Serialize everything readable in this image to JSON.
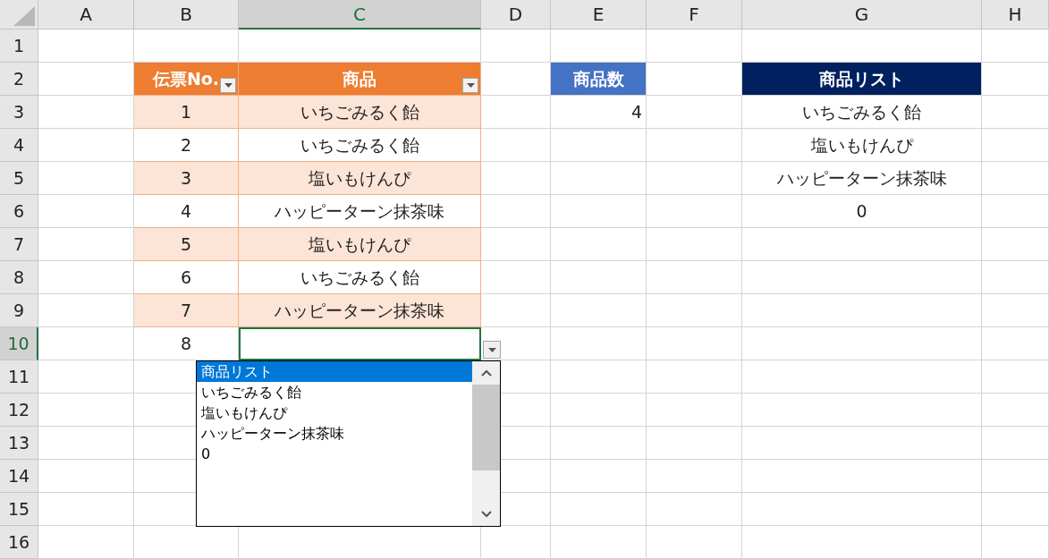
{
  "columns": [
    {
      "label": "A",
      "selected": false
    },
    {
      "label": "B",
      "selected": false
    },
    {
      "label": "C",
      "selected": true
    },
    {
      "label": "D",
      "selected": false
    },
    {
      "label": "E",
      "selected": false
    },
    {
      "label": "F",
      "selected": false
    },
    {
      "label": "G",
      "selected": false
    },
    {
      "label": "H",
      "selected": false
    }
  ],
  "rows": [
    {
      "label": "1",
      "selected": false
    },
    {
      "label": "2",
      "selected": false
    },
    {
      "label": "3",
      "selected": false
    },
    {
      "label": "4",
      "selected": false
    },
    {
      "label": "5",
      "selected": false
    },
    {
      "label": "6",
      "selected": false
    },
    {
      "label": "7",
      "selected": false
    },
    {
      "label": "8",
      "selected": false
    },
    {
      "label": "9",
      "selected": false
    },
    {
      "label": "10",
      "selected": true
    },
    {
      "label": "11",
      "selected": false
    },
    {
      "label": "12",
      "selected": false
    },
    {
      "label": "13",
      "selected": false
    },
    {
      "label": "14",
      "selected": false
    },
    {
      "label": "15",
      "selected": false
    },
    {
      "label": "16",
      "selected": false
    }
  ],
  "table": {
    "columns": [
      "伝票No.",
      "商品"
    ],
    "rows": [
      {
        "no": "1",
        "item": "いちごみるく飴"
      },
      {
        "no": "2",
        "item": "いちごみるく飴"
      },
      {
        "no": "3",
        "item": "塩いもけんぴ"
      },
      {
        "no": "4",
        "item": "ハッピーターン抹茶味"
      },
      {
        "no": "5",
        "item": "塩いもけんぴ"
      },
      {
        "no": "6",
        "item": "いちごみるく飴"
      },
      {
        "no": "7",
        "item": "ハッピーターン抹茶味"
      },
      {
        "no": "8"
      }
    ]
  },
  "count": {
    "header": "商品数",
    "value": "4"
  },
  "product_list": {
    "header": "商品リスト",
    "items": [
      "いちごみるく飴",
      "塩いもけんぴ",
      "ハッピーターン抹茶味",
      "0"
    ]
  },
  "dropdown": {
    "items": [
      {
        "label": "商品リスト",
        "selected": true
      },
      {
        "label": "いちごみるく飴",
        "selected": false
      },
      {
        "label": "塩いもけんぴ",
        "selected": false
      },
      {
        "label": "ハッピーターン抹茶味",
        "selected": false
      },
      {
        "label": "0",
        "selected": false
      }
    ]
  }
}
